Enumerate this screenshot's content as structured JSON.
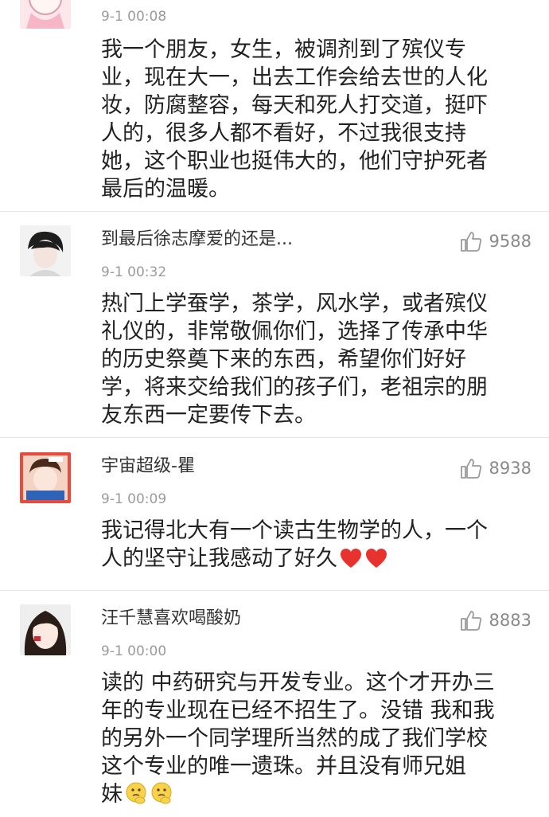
{
  "comments": [
    {
      "time": "9-1 00:08",
      "lines": [
        "我一个朋友，女生，被调剂到了殡仪专",
        "业，现在大一，出去工作会给去世的人化",
        "妆，防腐整容，每天和死人打交道，挺吓",
        "人的，很多人都不看好，不过我很支持",
        "她，这个职业也挺伟大的，他们守护死者",
        "最后的温暖。"
      ]
    },
    {
      "username": "到最后徐志摩爱的还是...",
      "likes": "9588",
      "time": "9-1 00:32",
      "lines": [
        "热门上学蚕学，茶学，风水学，或者殡仪",
        "礼仪的，非常敬佩你们，选择了传承中华",
        "的历史祭奠下来的东西，希望你们好好",
        "学，将来交给我们的孩子们，老祖宗的朋",
        "友东西一定要传下去。"
      ]
    },
    {
      "username": "宇宙超级-瞿",
      "likes": "8938",
      "time": "9-1 00:09",
      "lines": [
        "我记得北大有一个读古生物学的人，一个",
        "人的坚守让我感动了好久"
      ],
      "emoji": "heart"
    },
    {
      "username": "汪千慧喜欢喝酸奶",
      "likes": "8883",
      "time": "9-1 00:00",
      "lines": [
        "读的 中药研究与开发专业。这个才开办三",
        "年的专业现在已经不招生了。没错  我和我",
        "的另外一个同学理所当然的成了我们学校",
        "这个专业的唯一遗珠。并且没有师兄姐",
        "妹"
      ],
      "emoji": "thinking-face"
    }
  ],
  "colors": {
    "text": "#222222",
    "username": "#333333",
    "meta": "#9b9b9b",
    "separator": "#e6e6e6",
    "heart": "#e8322f"
  }
}
